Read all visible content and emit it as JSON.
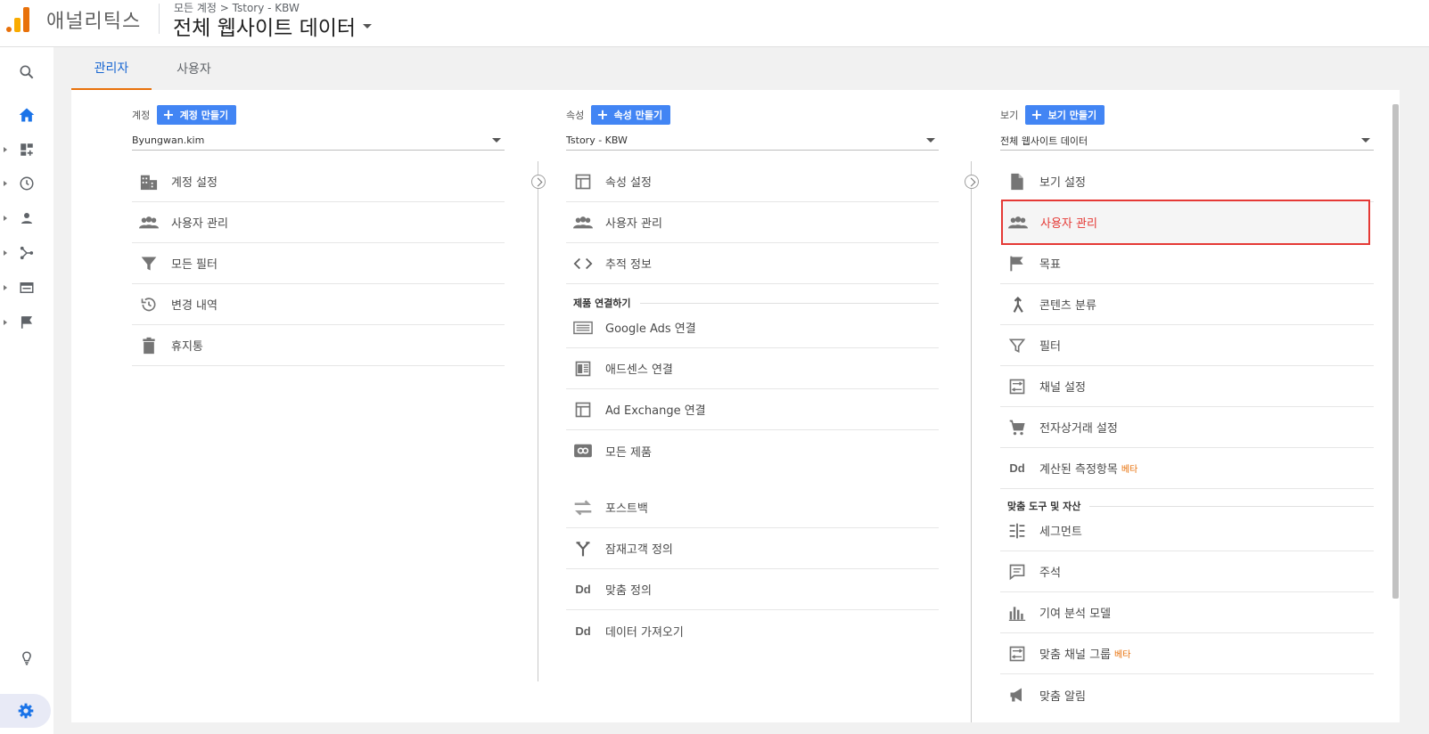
{
  "header": {
    "app_name": "애널리틱스",
    "breadcrumb": "모든 계정 > Tstory - KBW",
    "view_name": "전체 웹사이트 데이터"
  },
  "tabs": [
    "관리자",
    "사용자"
  ],
  "account": {
    "label": "계정",
    "create_label": "계정 만들기",
    "selected": "Byungwan.kim",
    "items": [
      "계정 설정",
      "사용자 관리",
      "모든 필터",
      "변경 내역",
      "휴지통"
    ]
  },
  "property": {
    "label": "속성",
    "create_label": "속성 만들기",
    "selected": "Tstory - KBW",
    "items": [
      "속성 설정",
      "사용자 관리",
      "추적 정보"
    ],
    "section_label": "제품 연결하기",
    "link_items": [
      "Google Ads 연결",
      "애드센스 연결",
      "Ad Exchange 연결",
      "모든 제품"
    ],
    "more_items": [
      "포스트백",
      "잠재고객 정의",
      "맞춤 정의",
      "데이터 가져오기"
    ]
  },
  "view": {
    "label": "보기",
    "create_label": "보기 만들기",
    "selected": "전체 웹사이트 데이터",
    "items": [
      "보기 설정",
      "사용자 관리",
      "목표",
      "콘텐츠 분류",
      "필터",
      "채널 설정",
      "전자상거래 설정",
      "계산된 측정항목"
    ],
    "beta": "베타",
    "section_label": "맞춤 도구 및 자산",
    "tool_items": [
      "세그먼트",
      "주석",
      "기여 분석 모델",
      "맞춤 채널 그룹",
      "맞춤 알림"
    ],
    "dd_text": "Dd"
  },
  "dd_icon_text": "Dd",
  "colors": {
    "accent": "#4285f4",
    "tab_underline": "#e8710a",
    "highlight": "#e53935"
  }
}
